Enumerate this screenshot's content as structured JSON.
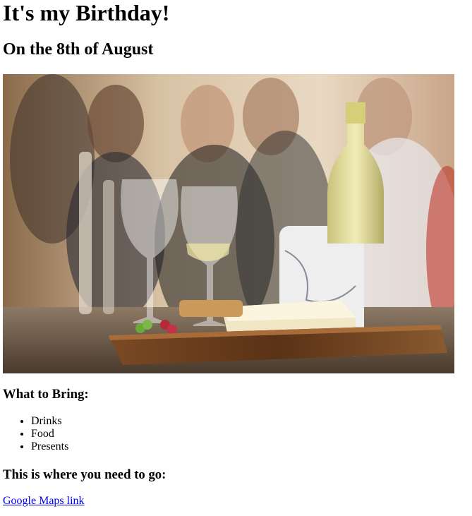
{
  "page": {
    "title": "It's my Birthday!",
    "subtitle": "On the 8th of August"
  },
  "hero_image": {
    "icon": "party-photo",
    "description_colors": {
      "background": "#d9c3a5",
      "board": "#6b3e1f",
      "wine": "#e8e1a0",
      "marble": "#e6e6e6"
    }
  },
  "bring": {
    "heading": "What to Bring:",
    "items": [
      "Drinks",
      "Food",
      "Presents"
    ]
  },
  "where": {
    "heading": "This is where you need to go:",
    "link_label": "Google Maps link"
  }
}
